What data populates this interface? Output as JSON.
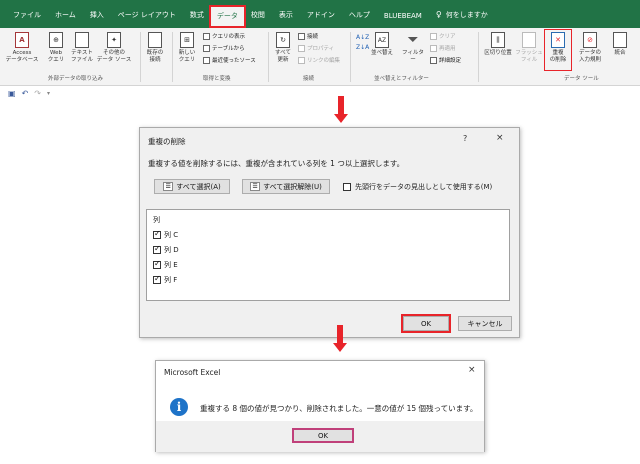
{
  "ribbon": {
    "tabs": [
      "ファイル",
      "ホーム",
      "挿入",
      "ページ レイアウト",
      "数式",
      "データ",
      "校閲",
      "表示",
      "アドイン",
      "ヘルプ",
      "BLUEBEAM"
    ],
    "tell_me": "何をしますか",
    "buttons": {
      "access": "Access\nデータベース",
      "web": "Web\nクエリ",
      "text": "テキスト\nファイル",
      "other": "その他の\nデータ ソース",
      "existing": "既存の\n接続",
      "new_query": "新しい\nクエリ",
      "refresh_all": "すべて\n更新",
      "sort": "並べ替え",
      "filter": "フィルター",
      "text_to_columns": "区切り位置",
      "flash_fill": "フラッシュ\nフィル",
      "remove_duplicates": "重複\nの削除",
      "data_validation": "データの\n入力規則",
      "consolidate": "統合"
    },
    "small": {
      "show_queries": "クエリの表示",
      "from_table": "テーブルから",
      "recent_sources": "最近使ったソース",
      "connections": "接続",
      "properties": "プロパティ",
      "edit_links": "リンクの編集",
      "clear": "クリア",
      "reapply": "再適用",
      "advanced": "詳細設定"
    },
    "groups": {
      "external": "外部データの取り込み",
      "get_transform": "取得と変換",
      "connections": "接続",
      "sort_filter": "並べ替えとフィルター",
      "data_tools": "データ ツール"
    }
  },
  "dialog_remove": {
    "title": "重複の削除",
    "help": "?",
    "close": "×",
    "instruction": "重複する値を削除するには、重複が含まれている列を 1 つ以上選択します。",
    "select_all": "すべて選択(A)",
    "unselect_all": "すべて選択解除(U)",
    "header_option": "先頭行をデータの見出しとして使用する(M)",
    "list_header": "列",
    "columns": [
      "列 C",
      "列 D",
      "列 E",
      "列 F"
    ],
    "ok": "OK",
    "cancel": "キャンセル"
  },
  "dialog_result": {
    "title": "Microsoft Excel",
    "close": "×",
    "message": "重複する 8 個の値が見つかり、削除されました。一意の値が 15 個残っています。",
    "ok": "OK"
  },
  "colors": {
    "ribbon_green": "#217346",
    "highlight_red": "#e8242a",
    "info_blue": "#1e73c8",
    "ok_border": "#c0407a"
  }
}
